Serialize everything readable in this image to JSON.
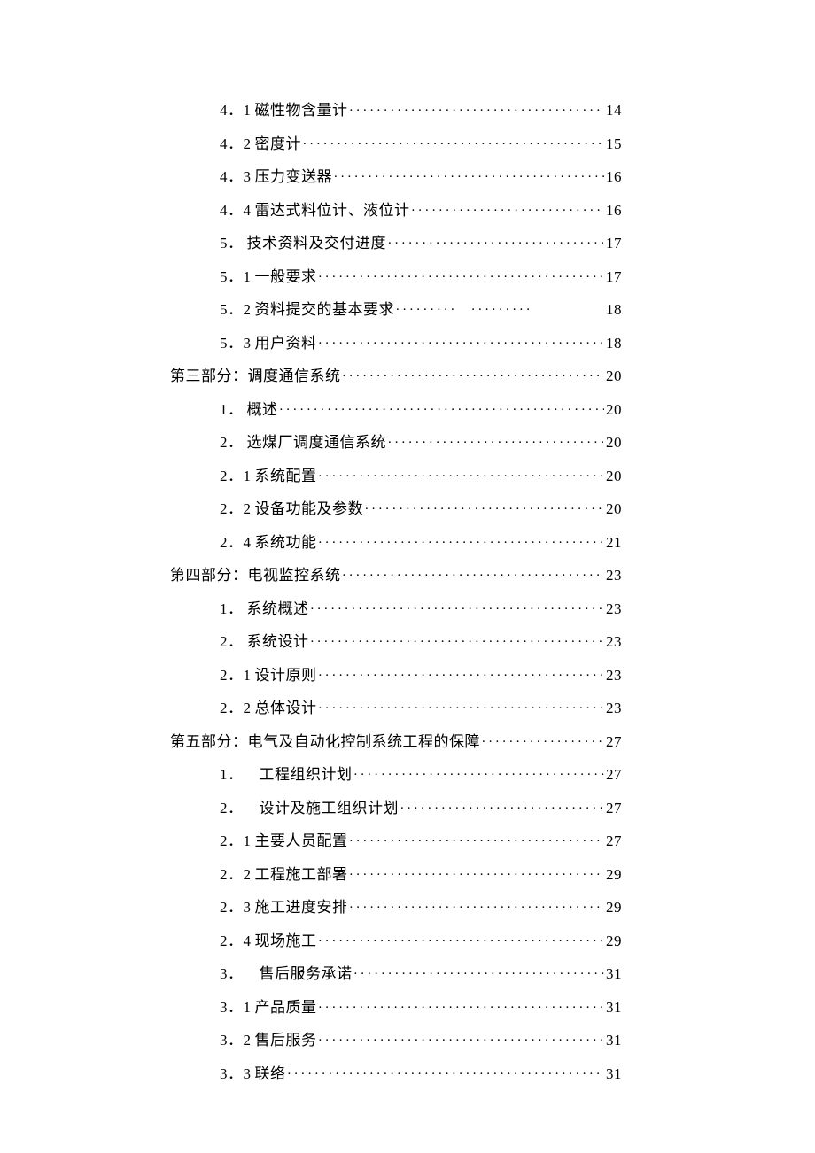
{
  "toc": [
    {
      "level": 2,
      "num": "4．1",
      "numWide": false,
      "title": "磁性物含量计",
      "page": "14",
      "split": false
    },
    {
      "level": 2,
      "num": "4．2",
      "numWide": false,
      "title": "密度计",
      "page": "15",
      "split": false
    },
    {
      "level": 2,
      "num": "4．3",
      "numWide": false,
      "title": "压力变送器",
      "page": "16",
      "split": false
    },
    {
      "level": 2,
      "num": "4．4",
      "numWide": false,
      "title": "雷达式料位计、液位计",
      "page": "16",
      "split": false
    },
    {
      "level": 1,
      "num": "5．",
      "numWide": false,
      "title": "技术资料及交付进度",
      "page": "17",
      "split": false
    },
    {
      "level": 2,
      "num": "5．1",
      "numWide": false,
      "title": "一般要求",
      "page": "17",
      "split": false
    },
    {
      "level": 2,
      "num": "5．2",
      "numWide": false,
      "title": "资料提交的基本要求",
      "page": "18",
      "split": true
    },
    {
      "level": 2,
      "num": "5．3",
      "numWide": false,
      "title": "用户资料",
      "page": "18",
      "split": false
    },
    {
      "level": 0,
      "num": "",
      "numWide": false,
      "title": "第三部分：调度通信系统",
      "page": "20",
      "split": false
    },
    {
      "level": 1,
      "num": "1．",
      "numWide": false,
      "title": "概述",
      "page": "20",
      "split": false
    },
    {
      "level": 1,
      "num": "2．",
      "numWide": false,
      "title": "选煤厂调度通信系统",
      "page": "20",
      "split": false
    },
    {
      "level": 2,
      "num": "2．1",
      "numWide": false,
      "title": "系统配置",
      "page": "20",
      "split": false
    },
    {
      "level": 2,
      "num": "2．2",
      "numWide": false,
      "title": "设备功能及参数",
      "page": "20",
      "split": false
    },
    {
      "level": 2,
      "num": "2．4",
      "numWide": false,
      "title": "系统功能",
      "page": "21",
      "split": false
    },
    {
      "level": 0,
      "num": "",
      "numWide": false,
      "title": "第四部分：电视监控系统",
      "page": "23",
      "split": false
    },
    {
      "level": 1,
      "num": "1．",
      "numWide": false,
      "title": "系统概述",
      "page": "23",
      "split": false
    },
    {
      "level": 1,
      "num": "2．",
      "numWide": false,
      "title": "系统设计",
      "page": "23",
      "split": false
    },
    {
      "level": 2,
      "num": "2．1",
      "numWide": false,
      "title": "设计原则",
      "page": "23",
      "split": false
    },
    {
      "level": 2,
      "num": "2．2",
      "numWide": false,
      "title": "总体设计",
      "page": "23",
      "split": false
    },
    {
      "level": 0,
      "num": "",
      "numWide": false,
      "title": "第五部分：电气及自动化控制系统工程的保障",
      "page": "27",
      "split": false
    },
    {
      "level": 1,
      "num": "1．",
      "numWide": true,
      "title": "工程组织计划",
      "page": "27",
      "split": false
    },
    {
      "level": 1,
      "num": "2．",
      "numWide": true,
      "title": "设计及施工组织计划",
      "page": "27",
      "split": false
    },
    {
      "level": 2,
      "num": "2．1",
      "numWide": false,
      "title": "主要人员配置",
      "page": "27",
      "split": false
    },
    {
      "level": 2,
      "num": "2．2",
      "numWide": false,
      "title": "工程施工部署",
      "page": "29",
      "split": false
    },
    {
      "level": 2,
      "num": "2．3",
      "numWide": false,
      "title": "施工进度安排",
      "page": "29",
      "split": false
    },
    {
      "level": 2,
      "num": "2．4",
      "numWide": false,
      "title": "现场施工",
      "page": "29",
      "split": false
    },
    {
      "level": 1,
      "num": "3．",
      "numWide": true,
      "title": "售后服务承诺",
      "page": "31",
      "split": false
    },
    {
      "level": 2,
      "num": "3．1",
      "numWide": false,
      "title": "产品质量",
      "page": "31",
      "split": false
    },
    {
      "level": 2,
      "num": "3．2",
      "numWide": false,
      "title": "售后服务",
      "page": "31",
      "split": false
    },
    {
      "level": 2,
      "num": "3．3",
      "numWide": false,
      "title": "联络",
      "page": "31",
      "split": false
    }
  ]
}
